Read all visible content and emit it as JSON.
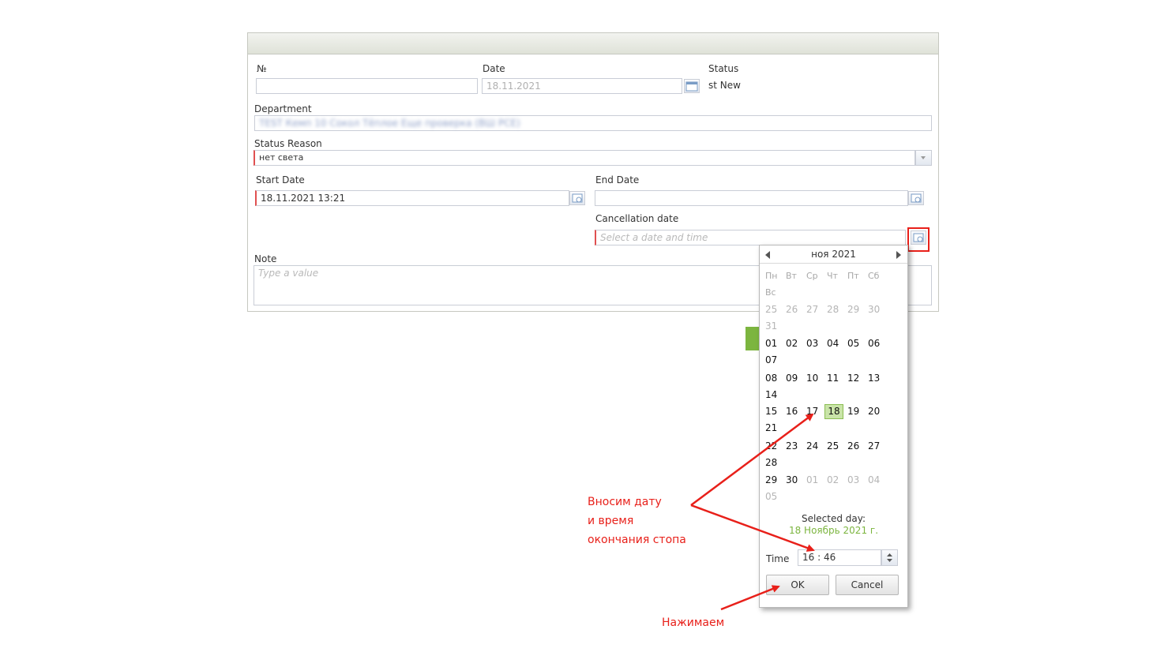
{
  "form": {
    "number_label": "№",
    "number_value": "",
    "date_label": "Date",
    "date_value": "18.11.2021",
    "status_label": "Status",
    "status_value": "st New",
    "department_label": "Department",
    "department_value": "TEST Кемп 10 Сокол Тёплое Еще проверка (ВШ РСЕ)",
    "status_reason_label": "Status Reason",
    "status_reason_value": "нет света",
    "start_date_label": "Start Date",
    "start_date_value": "18.11.2021 13:21",
    "end_date_label": "End Date",
    "end_date_value": "",
    "cancellation_label": "Cancellation date",
    "cancellation_placeholder": "Select a date and time",
    "note_label": "Note",
    "note_placeholder": "Type a value"
  },
  "calendar": {
    "month_year": "ноя 2021",
    "weekdays": [
      "Пн",
      "Вт",
      "Ср",
      "Чт",
      "Пт",
      "Сб",
      "Вс"
    ],
    "weeks": [
      [
        {
          "d": "25",
          "o": true
        },
        {
          "d": "26",
          "o": true
        },
        {
          "d": "27",
          "o": true
        },
        {
          "d": "28",
          "o": true
        },
        {
          "d": "29",
          "o": true
        },
        {
          "d": "30",
          "o": true
        },
        {
          "d": "31",
          "o": true
        }
      ],
      [
        {
          "d": "01"
        },
        {
          "d": "02"
        },
        {
          "d": "03"
        },
        {
          "d": "04"
        },
        {
          "d": "05"
        },
        {
          "d": "06"
        },
        {
          "d": "07"
        }
      ],
      [
        {
          "d": "08"
        },
        {
          "d": "09"
        },
        {
          "d": "10"
        },
        {
          "d": "11"
        },
        {
          "d": "12"
        },
        {
          "d": "13"
        },
        {
          "d": "14"
        }
      ],
      [
        {
          "d": "15"
        },
        {
          "d": "16"
        },
        {
          "d": "17"
        },
        {
          "d": "18",
          "s": true
        },
        {
          "d": "19"
        },
        {
          "d": "20"
        },
        {
          "d": "21"
        }
      ],
      [
        {
          "d": "22"
        },
        {
          "d": "23"
        },
        {
          "d": "24"
        },
        {
          "d": "25"
        },
        {
          "d": "26"
        },
        {
          "d": "27"
        },
        {
          "d": "28"
        }
      ],
      [
        {
          "d": "29"
        },
        {
          "d": "30"
        },
        {
          "d": "01",
          "o": true
        },
        {
          "d": "02",
          "o": true
        },
        {
          "d": "03",
          "o": true
        },
        {
          "d": "04",
          "o": true
        },
        {
          "d": "05",
          "o": true
        }
      ]
    ],
    "selected_day_label": "Selected day:",
    "selected_day_value": "18 Ноябрь 2021 г.",
    "time_label": "Time",
    "time_value": "16 : 46",
    "ok_label": "OK",
    "cancel_label": "Cancel"
  },
  "annotations": {
    "line1": "Вносим дату",
    "line2": "и время",
    "line3": "окончания стопа",
    "press": "Нажимаем",
    "color": "#e8201a"
  },
  "colors": {
    "selected_day": "#c9e4a8",
    "selected_text": "#7cb53f",
    "required_border": "#e05050",
    "highlight_box": "#e8201a"
  }
}
